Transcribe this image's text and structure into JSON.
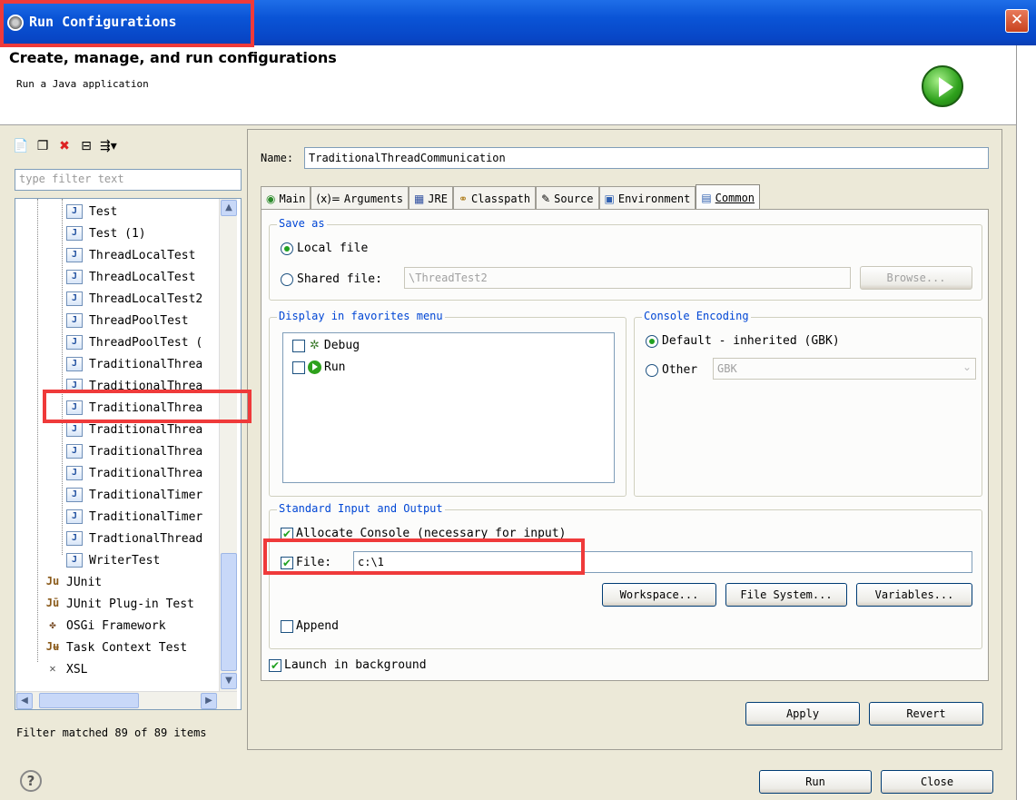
{
  "window": {
    "title": "Run Configurations"
  },
  "header": {
    "title": "Create, manage, and run configurations",
    "subtitle": "Run a Java application"
  },
  "left": {
    "filter_placeholder": "type filter text",
    "tree_items": [
      "Test",
      "Test (1)",
      "ThreadLocalTest",
      "ThreadLocalTest",
      "ThreadLocalTest2",
      "ThreadPoolTest",
      "ThreadPoolTest (",
      "TraditionalThrea",
      "TraditionalThrea",
      "TraditionalThrea",
      "TraditionalThrea",
      "TraditionalThrea",
      "TraditionalThrea",
      "TraditionalTimer",
      "TraditionalTimer",
      "TradtionalThread",
      "WriterTest"
    ],
    "categories": [
      "JUnit",
      "JUnit Plug-in Test",
      "OSGi Framework",
      "Task Context Test",
      "XSL"
    ],
    "filter_status": "Filter matched 89 of 89 items"
  },
  "config": {
    "name_label": "Name:",
    "name_value": "TraditionalThreadCommunication",
    "tabs": [
      "Main",
      "Arguments",
      "JRE",
      "Classpath",
      "Source",
      "Environment",
      "Common"
    ],
    "save_as": {
      "title": "Save as",
      "local_file": "Local file",
      "shared_file": "Shared file:",
      "shared_value": "\\ThreadTest2",
      "browse": "Browse..."
    },
    "favorites": {
      "title": "Display in favorites menu",
      "items": [
        "Debug",
        "Run"
      ]
    },
    "encoding": {
      "title": "Console Encoding",
      "default": "Default - inherited (GBK)",
      "other": "Other",
      "other_value": "GBK"
    },
    "io": {
      "title": "Standard Input and Output",
      "allocate_console": "Allocate Console (necessary for input)",
      "file_label": "File:",
      "file_value": "c:\\1",
      "workspace": "Workspace...",
      "file_system": "File System...",
      "variables": "Variables...",
      "append": "Append"
    },
    "launch_background": "Launch in background",
    "apply": "Apply",
    "revert": "Revert"
  },
  "footer": {
    "run": "Run",
    "close": "Close"
  }
}
